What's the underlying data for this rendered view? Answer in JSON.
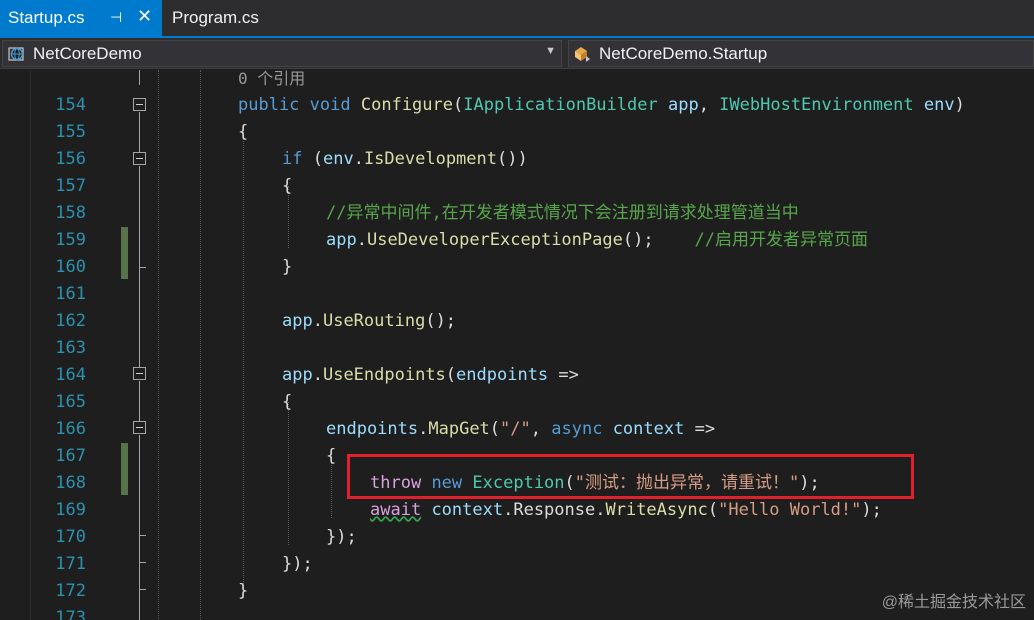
{
  "tabs": {
    "active_label": "Startup.cs",
    "pin_glyph": "⊣",
    "close_glyph": "✕",
    "inactive_label": "Program.cs"
  },
  "navbar": {
    "project": "NetCoreDemo",
    "type": "NetCoreDemo.Startup"
  },
  "code_lens": "0 个引用",
  "lines": [
    {
      "no": "154"
    },
    {
      "no": "155"
    },
    {
      "no": "156"
    },
    {
      "no": "157"
    },
    {
      "no": "158"
    },
    {
      "no": "159"
    },
    {
      "no": "160"
    },
    {
      "no": "161"
    },
    {
      "no": "162"
    },
    {
      "no": "163"
    },
    {
      "no": "164"
    },
    {
      "no": "165"
    },
    {
      "no": "166"
    },
    {
      "no": "167"
    },
    {
      "no": "168"
    },
    {
      "no": "169"
    },
    {
      "no": "170"
    },
    {
      "no": "171"
    },
    {
      "no": "172"
    },
    {
      "no": "173"
    }
  ],
  "code": {
    "l154": {
      "t1": "public",
      "t2": "void",
      "t3": "Configure",
      "t4": "(",
      "t5": "IApplicationBuilder",
      "t6": "app",
      "t7": ", ",
      "t8": "IWebHostEnvironment",
      "t9": "env",
      "t10": ")"
    },
    "l155": {
      "t1": "{"
    },
    "l156": {
      "t1": "if",
      "t2": " (",
      "t3": "env",
      "t4": ".",
      "t5": "IsDevelopment",
      "t6": "())"
    },
    "l157": {
      "t1": "{"
    },
    "l158": {
      "t1": "//异常中间件,在开发者模式情况下会注册到请求处理管道当中"
    },
    "l159": {
      "t1": "app",
      "t2": ".",
      "t3": "UseDeveloperExceptionPage",
      "t4": "();",
      "t5": "//启用开发者异常页面"
    },
    "l160": {
      "t1": "}"
    },
    "l162": {
      "t1": "app",
      "t2": ".",
      "t3": "UseRouting",
      "t4": "();"
    },
    "l164": {
      "t1": "app",
      "t2": ".",
      "t3": "UseEndpoints",
      "t4": "(",
      "t5": "endpoints",
      "t6": " =>"
    },
    "l165": {
      "t1": "{"
    },
    "l166": {
      "t1": "endpoints",
      "t2": ".",
      "t3": "MapGet",
      "t4": "(",
      "t5": "\"/\"",
      "t6": ", ",
      "t7": "async",
      "t8": "context",
      "t9": " =>"
    },
    "l167": {
      "t1": "{"
    },
    "l168": {
      "t1": "throw",
      "t2": "new",
      "t3": "Exception",
      "t4": "(",
      "t5": "\"测试：抛出异常，请重试！\"",
      "t6": ");"
    },
    "l169": {
      "t1": "await",
      "t2": "context",
      "t3": ".",
      "t4": "Response",
      "t5": ".",
      "t6": "WriteAsync",
      "t7": "(",
      "t8": "\"Hello World!\"",
      "t9": ");"
    },
    "l170": {
      "t1": "});"
    },
    "l171": {
      "t1": "});"
    },
    "l172": {
      "t1": "}"
    }
  },
  "watermark": "@稀土掘金技术社区",
  "colors": {
    "accent": "#007acc",
    "keyword": "#569cd6",
    "type": "#4ec9b0",
    "method": "#dcdcaa",
    "variable": "#9cdcfe",
    "string": "#d69d85",
    "comment": "#57a64a",
    "highlight_box": "#e0202a"
  }
}
